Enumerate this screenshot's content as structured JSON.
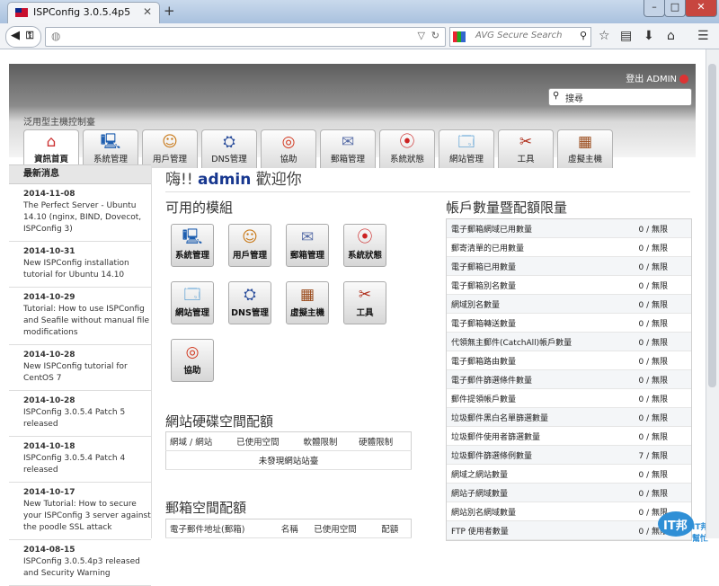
{
  "browser": {
    "tab_title": "ISPConfig 3.0.5.4p5",
    "search_placeholder": "AVG Secure Search"
  },
  "header": {
    "logout_label": "登出 ADMIN",
    "search_placeholder": "搜尋",
    "subtitle": "泛用型主機控制臺",
    "modules": [
      {
        "label": "資訊首頁",
        "icon": "home-icon"
      },
      {
        "label": "系統管理",
        "icon": "computer-icon"
      },
      {
        "label": "用戶管理",
        "icon": "users-icon"
      },
      {
        "label": "DNS管理",
        "icon": "dns-icon"
      },
      {
        "label": "協助",
        "icon": "lifebuoy-icon"
      },
      {
        "label": "郵箱管理",
        "icon": "envelope-icon"
      },
      {
        "label": "系統狀態",
        "icon": "traffic-light-icon"
      },
      {
        "label": "網站管理",
        "icon": "website-icon"
      },
      {
        "label": "工具",
        "icon": "tools-icon"
      },
      {
        "label": "虛擬主機",
        "icon": "cabinet-icon"
      }
    ]
  },
  "sidebar": {
    "title": "最新消息",
    "news": [
      {
        "date": "2014-11-08",
        "text": "The Perfect Server - Ubuntu 14.10 (nginx, BIND, Dovecot, ISPConfig 3)"
      },
      {
        "date": "2014-10-31",
        "text": "New ISPConfig installation tutorial for Ubuntu 14.10"
      },
      {
        "date": "2014-10-29",
        "text": "Tutorial: How to use ISPConfig and Seafile without manual file modifications"
      },
      {
        "date": "2014-10-28",
        "text": "New ISPConfig tutorial for CentOS 7"
      },
      {
        "date": "2014-10-28",
        "text": "ISPConfig 3.0.5.4 Patch 5 released"
      },
      {
        "date": "2014-10-18",
        "text": "ISPConfig 3.0.5.4 Patch 4 released"
      },
      {
        "date": "2014-10-17",
        "text": "New Tutorial: How to secure your ISPConfig 3 server against the poodle SSL attack"
      },
      {
        "date": "2014-08-15",
        "text": "ISPConfig 3.0.5.4p3 released and Security Warning"
      }
    ]
  },
  "main": {
    "welcome_prefix": "嗨!!",
    "welcome_user": "admin",
    "welcome_suffix": "歡迎你",
    "modules_title": "可用的模組",
    "module_buttons": [
      "系統管理",
      "用戶管理",
      "郵箱管理",
      "系統狀態",
      "網站管理",
      "DNS管理",
      "虛擬主機",
      "工具",
      "協助"
    ],
    "web_quota": {
      "title": "網站硬碟空間配額",
      "headers": [
        "網域 / 網站",
        "已使用空間",
        "軟體限制",
        "硬體限制"
      ],
      "empty": "未發現網站站臺"
    },
    "mail_quota": {
      "title": "郵箱空間配額",
      "headers": [
        "電子郵件地址(郵箱)",
        "名稱",
        "已使用空間",
        "配額"
      ]
    },
    "limits": {
      "title": "帳戶數量暨配額限量",
      "rows": [
        {
          "label": "電子郵箱網域已用數量",
          "value": "0 / 無限"
        },
        {
          "label": "郵寄清單的已用數量",
          "value": "0 / 無限"
        },
        {
          "label": "電子郵箱已用數量",
          "value": "0 / 無限"
        },
        {
          "label": "電子郵箱別名數量",
          "value": "0 / 無限"
        },
        {
          "label": "網域別名數量",
          "value": "0 / 無限"
        },
        {
          "label": "電子郵箱轉送數量",
          "value": "0 / 無限"
        },
        {
          "label": "代領無主郵件(CatchAll)帳戶數量",
          "value": "0 / 無限"
        },
        {
          "label": "電子郵箱路由數量",
          "value": "0 / 無限"
        },
        {
          "label": "電子郵件篩選條件數量",
          "value": "0 / 無限"
        },
        {
          "label": "郵件提領帳戶數量",
          "value": "0 / 無限"
        },
        {
          "label": "垃圾郵件黑白名單篩選數量",
          "value": "0 / 無限"
        },
        {
          "label": "垃圾郵件使用者篩選數量",
          "value": "0 / 無限"
        },
        {
          "label": "垃圾郵件篩選條例數量",
          "value": "7 / 無限"
        },
        {
          "label": "網域之網站數量",
          "value": "0 / 無限"
        },
        {
          "label": "網站子網域數量",
          "value": "0 / 無限"
        },
        {
          "label": "網站別名網域數量",
          "value": "0 / 無限"
        },
        {
          "label": "FTP 使用者數量",
          "value": "0 / 無限"
        }
      ]
    }
  },
  "watermark": "IT邦幫忙"
}
